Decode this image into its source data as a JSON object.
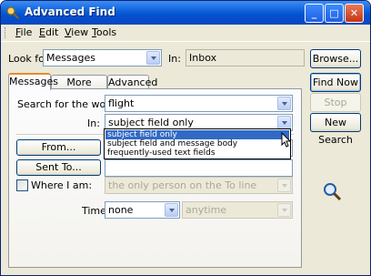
{
  "window": {
    "title": "Advanced Find"
  },
  "menu": [
    {
      "label": "File",
      "u": "F"
    },
    {
      "label": "Edit",
      "u": "E"
    },
    {
      "label": "View",
      "u": "V"
    },
    {
      "label": "Tools",
      "u": "T"
    }
  ],
  "lookfor": {
    "label": "Look for:",
    "value": "Messages",
    "in_label": "In:",
    "in_value": "Inbox"
  },
  "tabs": [
    "Messages",
    "More Choices",
    "Advanced"
  ],
  "search": {
    "label": "Search for the word(s):",
    "value": "flight"
  },
  "in_field": {
    "label": "In:",
    "value": "subject field only"
  },
  "dropdown_options": [
    "subject field only",
    "subject field and message body",
    "frequently-used text fields"
  ],
  "buttons": {
    "browse": "Browse...",
    "find_now": "Find Now",
    "stop": "Stop",
    "new_search": "New Search",
    "from": "From...",
    "sent_to": "Sent To..."
  },
  "where": {
    "label": "Where I am:",
    "value": "the only person on the To line"
  },
  "time": {
    "label": "Time:",
    "value": "none",
    "second": "anytime"
  }
}
